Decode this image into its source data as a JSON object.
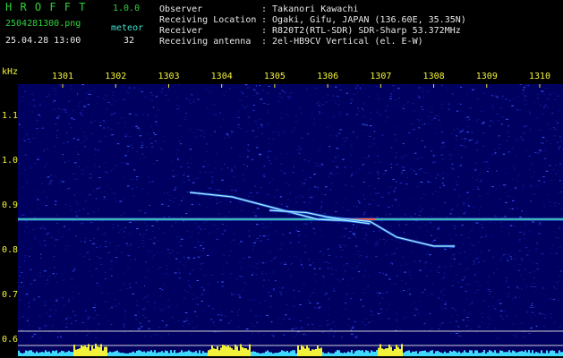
{
  "header": {
    "app_name": "H R O F F T",
    "version": "1.0.0",
    "filename": "2504281300.png",
    "mode_label": "meteor",
    "timestamp": "25.04.28 13:00",
    "count": "32",
    "fields": [
      {
        "label": "Observer",
        "value": ": Takanori Kawachi"
      },
      {
        "label": "Receiving Location",
        "value": ": Ogaki, Gifu, JAPAN (136.60E, 35.35N)"
      },
      {
        "label": "Receiver",
        "value": ": R820T2(RTL-SDR) SDR-Sharp 53.372MHz"
      },
      {
        "label": "Receiving antenna",
        "value": ": 2el-HB9CV Vertical (el. E-W)"
      }
    ]
  },
  "chart_data": {
    "type": "heatmap",
    "ylabel": "kHz",
    "x_ticks": [
      "1301",
      "1302",
      "1303",
      "1304",
      "1305",
      "1306",
      "1307",
      "1308",
      "1309",
      "1310"
    ],
    "y_ticks": [
      "1.1",
      "1.0",
      "0.9",
      "0.8",
      "0.7",
      "0.6"
    ],
    "ylim": [
      0.58,
      1.18
    ],
    "carrier_khz": 0.87,
    "traces": [
      {
        "x": [
          1303.4,
          1304.2,
          1305.0,
          1305.8,
          1306.6
        ],
        "y": [
          0.93,
          0.92,
          0.895,
          0.87,
          0.865
        ]
      },
      {
        "x": [
          1306.0,
          1306.8,
          1307.3,
          1308.0,
          1308.4
        ],
        "y": [
          0.875,
          0.865,
          0.83,
          0.81,
          0.81
        ]
      },
      {
        "x": [
          1304.9,
          1305.6,
          1306.2,
          1306.8
        ],
        "y": [
          0.89,
          0.885,
          0.87,
          0.86
        ]
      }
    ],
    "colors": {
      "background": "#000060",
      "carrier": "#4fe08a",
      "trace": "#a8f0ff",
      "hot": "#ff6040",
      "bars": "#3fd8ff",
      "bar_peak": "#f2f23a"
    }
  }
}
